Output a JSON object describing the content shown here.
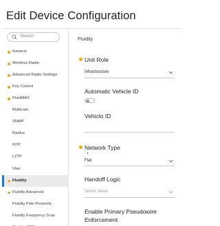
{
  "header": {
    "title": "Edit Device Configuration"
  },
  "search": {
    "placeholder": "Search"
  },
  "sidebar": {
    "items": [
      {
        "label": "General",
        "required": true,
        "active": false
      },
      {
        "label": "Wireless Radio",
        "required": true,
        "active": false
      },
      {
        "label": "Advanced Radio Settings",
        "required": true,
        "active": false
      },
      {
        "label": "Key Control",
        "required": true,
        "active": false
      },
      {
        "label": "FluidMAX",
        "required": true,
        "active": false
      },
      {
        "label": "Multicast",
        "required": false,
        "active": false
      },
      {
        "label": "SNMP",
        "required": false,
        "active": false
      },
      {
        "label": "Radius",
        "required": false,
        "active": false
      },
      {
        "label": "NTP",
        "required": false,
        "active": false
      },
      {
        "label": "L2TP",
        "required": false,
        "active": false
      },
      {
        "label": "Vlan",
        "required": false,
        "active": false
      },
      {
        "label": "Fluidity",
        "required": true,
        "active": true
      },
      {
        "label": "Fluidity Advanced",
        "required": true,
        "active": false
      },
      {
        "label": "Fluidity Pole Proximity",
        "required": false,
        "active": false
      },
      {
        "label": "Fluidity Frequency Scan",
        "required": false,
        "active": false
      },
      {
        "label": "Fluidity MPO",
        "required": true,
        "active": false
      }
    ]
  },
  "main": {
    "section_title": "Fluidity",
    "unit_role": {
      "label": "Unit Role",
      "value": "Infrastructure",
      "required": true
    },
    "automatic_vehicle_id": {
      "label": "Automatic Vehicle ID",
      "enabled": false
    },
    "vehicle_id": {
      "label": "Vehiclo ID",
      "value": ""
    },
    "network_type": {
      "label": "Network Type",
      "value": "Flat",
      "required": true
    },
    "handoff_logic": {
      "label": "Handoff Logic",
      "placeholder": "Select Value"
    },
    "enable_primary_pseudowire": {
      "label_line1": "Enable Primary Pseudowire",
      "label_line2": "Enforcement"
    }
  },
  "colors": {
    "required_dot": "#f0a51b",
    "active_bar": "#1a77d2",
    "active_bg": "#eaeaea"
  }
}
